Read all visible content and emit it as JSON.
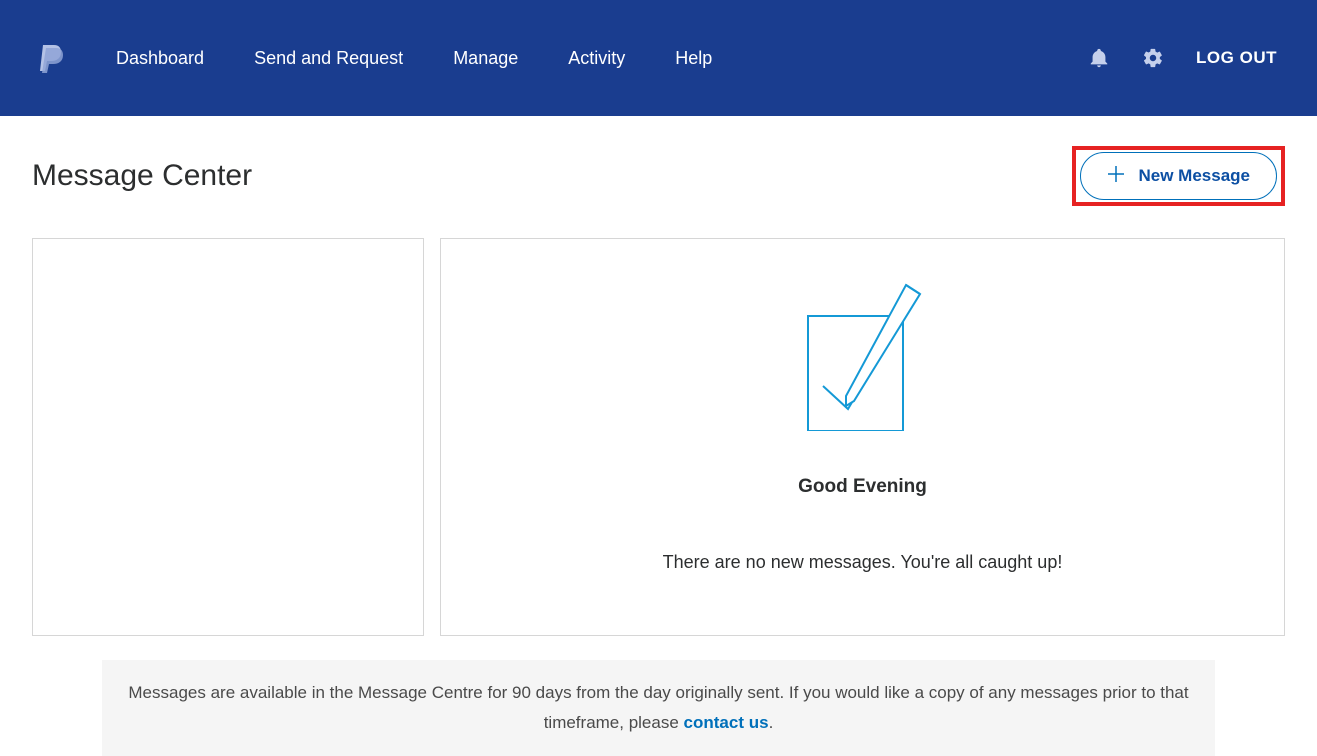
{
  "nav": {
    "items": [
      "Dashboard",
      "Send and Request",
      "Manage",
      "Activity",
      "Help"
    ],
    "logout": "LOG OUT"
  },
  "page": {
    "title": "Message Center",
    "new_message_label": "New Message"
  },
  "inbox": {
    "greeting": "Good Evening",
    "status": "There are no new messages. You're all caught up!"
  },
  "footer": {
    "notice_prefix": "Messages are available in the Message Centre for 90 days from the day originally sent. If you would like a copy of any messages prior to that timeframe, please ",
    "contact_label": "contact us",
    "notice_suffix": "."
  }
}
